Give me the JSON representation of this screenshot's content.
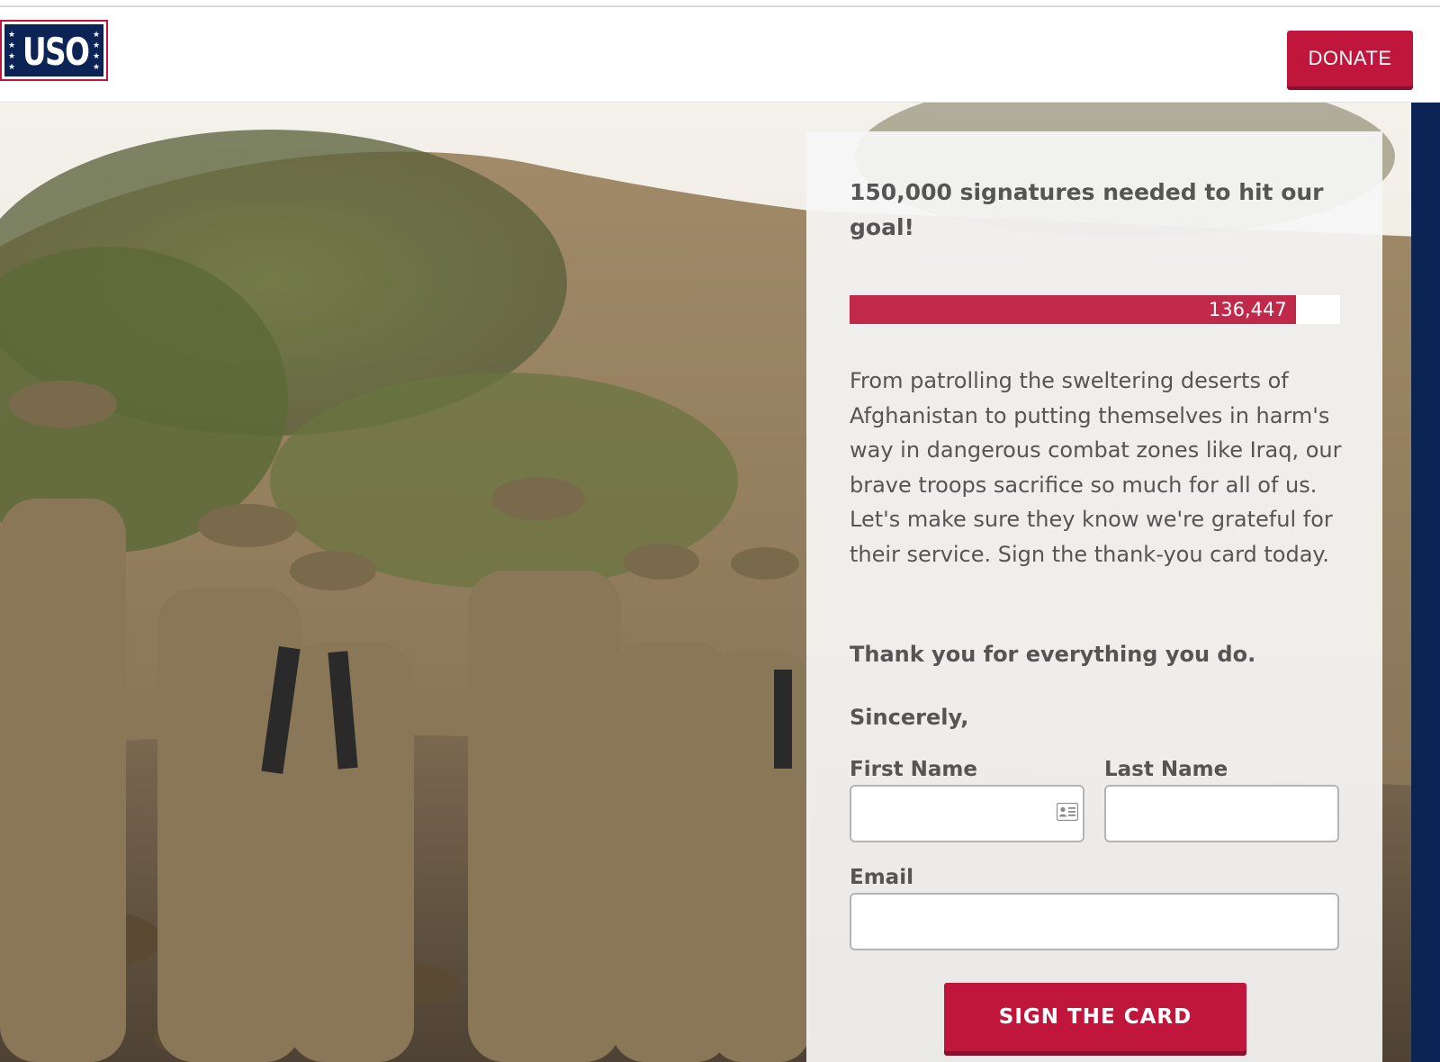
{
  "header": {
    "logo_text": "USO",
    "donate_label": "DONATE"
  },
  "colors": {
    "brand_red": "#c0163c",
    "brand_navy": "#0b2455",
    "text_gray": "#555555"
  },
  "petition": {
    "goal_text": "150,000 signatures needed to hit our goal!",
    "goal": 150000,
    "signature_count": 136447,
    "signature_count_label": "136,447",
    "body": "From patrolling the sweltering deserts of Afghanistan to putting themselves in harm's way in dangerous combat zones like Iraq, our brave troops sacrifice so much for all of us. Let's make sure they know we're grateful for their service. Sign the thank-you card today.",
    "thanks": "Thank you for everything you do.",
    "sincerely": "Sincerely,"
  },
  "form": {
    "first_name_label": "First Name",
    "first_name_value": "",
    "last_name_label": "Last Name",
    "last_name_value": "",
    "email_label": "Email",
    "email_value": "",
    "submit_label": "SIGN THE CARD"
  },
  "icons": {
    "contact_card": "contact-card-icon"
  }
}
